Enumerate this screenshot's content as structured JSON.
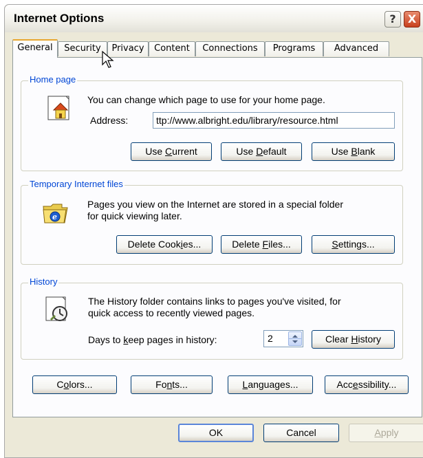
{
  "window": {
    "title": "Internet Options",
    "help_glyph": "?",
    "close_glyph": "X"
  },
  "tabs": [
    {
      "label": "General",
      "active": true
    },
    {
      "label": "Security"
    },
    {
      "label": "Privacy"
    },
    {
      "label": "Content"
    },
    {
      "label": "Connections"
    },
    {
      "label": "Programs"
    },
    {
      "label": "Advanced"
    }
  ],
  "home_page": {
    "legend": "Home page",
    "description": "You can change which page to use for your home page.",
    "address_label": "Address:",
    "address_value": "ttp://www.albright.edu/library/resource.html",
    "buttons": {
      "use_current": {
        "pre": "Use ",
        "key": "C",
        "post": "urrent"
      },
      "use_default": {
        "pre": "Use ",
        "key": "D",
        "post": "efault"
      },
      "use_blank": {
        "pre": "Use ",
        "key": "B",
        "post": "lank"
      }
    }
  },
  "temp_files": {
    "legend": "Temporary Internet files",
    "description_line1": "Pages you view on the Internet are stored in a special folder",
    "description_line2": "for quick viewing later.",
    "buttons": {
      "delete_cookies": {
        "pre": "Delete Cook",
        "key": "i",
        "post": "es..."
      },
      "delete_files": {
        "pre": "Delete ",
        "key": "F",
        "post": "iles..."
      },
      "settings": {
        "pre": "",
        "key": "S",
        "post": "ettings..."
      }
    }
  },
  "history": {
    "legend": "History",
    "description_line1": "The History folder contains links to pages you've visited, for",
    "description_line2": "quick access to recently viewed pages.",
    "days_label": {
      "pre": "Days to ",
      "key": "k",
      "post": "eep pages in history:"
    },
    "days_value": "2",
    "clear_button": {
      "pre": "Clear ",
      "key": "H",
      "post": "istory"
    }
  },
  "bottom_buttons": {
    "colors": {
      "pre": "C",
      "key": "o",
      "post": "lors..."
    },
    "fonts": {
      "pre": "Fo",
      "key": "n",
      "post": "ts..."
    },
    "languages": {
      "pre": "",
      "key": "L",
      "post": "anguages..."
    },
    "accessibility": {
      "pre": "Acc",
      "key": "e",
      "post": "ssibility..."
    }
  },
  "dialog_buttons": {
    "ok": "OK",
    "cancel": "Cancel",
    "apply": {
      "pre": "",
      "key": "A",
      "post": "pply"
    }
  },
  "colors": {
    "legend_text": "#0046d5",
    "active_tab_accent": "#e8a62e",
    "close_button": "#c8401d"
  }
}
